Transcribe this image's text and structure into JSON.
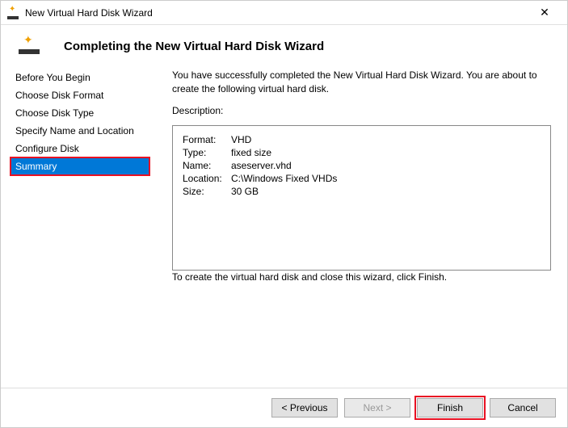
{
  "window": {
    "title": "New Virtual Hard Disk Wizard"
  },
  "header": {
    "title": "Completing the New Virtual Hard Disk Wizard"
  },
  "sidebar": {
    "steps": [
      "Before You Begin",
      "Choose Disk Format",
      "Choose Disk Type",
      "Specify Name and Location",
      "Configure Disk",
      "Summary"
    ],
    "active_index": 5
  },
  "main": {
    "intro": "You have successfully completed the New Virtual Hard Disk Wizard. You are about to create the following virtual hard disk.",
    "description_label": "Description:",
    "rows": {
      "format_k": "Format:",
      "format_v": "VHD",
      "type_k": "Type:",
      "type_v": "fixed size",
      "name_k": "Name:",
      "name_v": "aseserver.vhd",
      "location_k": "Location:",
      "location_v": "C:\\Windows Fixed VHDs",
      "size_k": "Size:",
      "size_v": "30 GB"
    },
    "closing": "To create the virtual hard disk and close this wizard, click Finish."
  },
  "buttons": {
    "previous": "< Previous",
    "next": "Next >",
    "finish": "Finish",
    "cancel": "Cancel"
  }
}
